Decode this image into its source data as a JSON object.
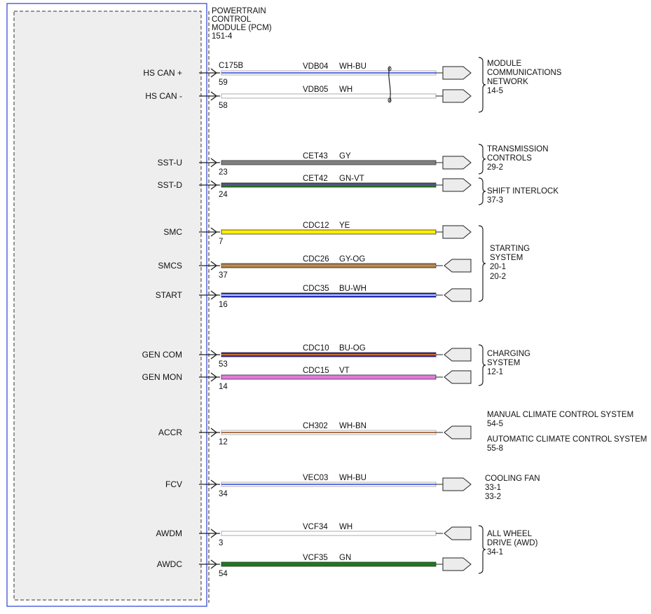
{
  "module": {
    "title_lines": [
      "POWERTRAIN",
      "CONTROL",
      "MODULE (PCM)",
      "151-4"
    ]
  },
  "connector": "C175B",
  "colors": {
    "module_border": "#2a3fd6",
    "module_fill": "#eeeeee",
    "connector_fill": "#ececec"
  },
  "wires": [
    {
      "pin_label": "HS CAN +",
      "pin": "59",
      "circuit": "VDB04",
      "color_code": "WH-BU",
      "fill": "#ffffff",
      "stripe": "#2a3fd6",
      "twisted": true,
      "direction": "out"
    },
    {
      "pin_label": "HS CAN -",
      "pin": "58",
      "circuit": "VDB05",
      "color_code": "WH",
      "fill": "#ffffff",
      "stripe": "",
      "twisted": true,
      "direction": "out"
    },
    {
      "pin_label": "SST-U",
      "pin": "23",
      "circuit": "CET43",
      "color_code": "GY",
      "fill": "#808080",
      "stripe": "",
      "direction": "out"
    },
    {
      "pin_label": "SST-D",
      "pin": "24",
      "circuit": "CET42",
      "color_code": "GN-VT",
      "fill": "#1e7a1e",
      "stripe": "#8a2be2",
      "direction": "out"
    },
    {
      "pin_label": "SMC",
      "pin": "7",
      "circuit": "CDC12",
      "color_code": "YE",
      "fill": "#ffee00",
      "stripe": "",
      "direction": "out"
    },
    {
      "pin_label": "SMCS",
      "pin": "37",
      "circuit": "CDC26",
      "color_code": "GY-OG",
      "fill": "#9a7a55",
      "stripe": "#ff8c00",
      "direction": "in"
    },
    {
      "pin_label": "START",
      "pin": "16",
      "circuit": "CDC35",
      "color_code": "BU-WH",
      "fill": "#1f2fd0",
      "stripe": "#ffffff",
      "direction": "in"
    },
    {
      "pin_label": "GEN COM",
      "pin": "53",
      "circuit": "CDC10",
      "color_code": "BU-OG",
      "fill": "#3a1fb0",
      "stripe": "#ff8c00",
      "direction": "in"
    },
    {
      "pin_label": "GEN MON",
      "pin": "14",
      "circuit": "CDC15",
      "color_code": "VT",
      "fill": "#e07ae0",
      "stripe": "",
      "direction": "in"
    },
    {
      "pin_label": "ACCR",
      "pin": "12",
      "circuit": "CH302",
      "color_code": "WH-BN",
      "fill": "#ffffff",
      "stripe": "#8b4513",
      "direction": "in"
    },
    {
      "pin_label": "FCV",
      "pin": "34",
      "circuit": "VEC03",
      "color_code": "WH-BU",
      "fill": "#ffffff",
      "stripe": "#2a3fd6",
      "direction": "out"
    },
    {
      "pin_label": "AWDM",
      "pin": "3",
      "circuit": "VCF34",
      "color_code": "WH",
      "fill": "#ffffff",
      "stripe": "",
      "direction": "in"
    },
    {
      "pin_label": "AWDC",
      "pin": "54",
      "circuit": "VCF35",
      "color_code": "GN",
      "fill": "#1e7a1e",
      "stripe": "",
      "direction": "out"
    }
  ],
  "destinations": [
    {
      "lines": [
        "MODULE",
        "COMMUNICATIONS",
        "NETWORK",
        "14-5"
      ],
      "bracket": true
    },
    {
      "lines": [
        "TRANSMISSION",
        "CONTROLS",
        "29-2"
      ],
      "bracket": true
    },
    {
      "lines": [
        "SHIFT INTERLOCK",
        "37-3"
      ],
      "bracket": true
    },
    {
      "lines": [
        "STARTING",
        "SYSTEM",
        "20-1",
        "20-2"
      ],
      "bracket": true
    },
    {
      "lines": [
        "CHARGING",
        "SYSTEM",
        "12-1"
      ],
      "bracket": true
    },
    {
      "lines": [
        "MANUAL CLIMATE CONTROL SYSTEM",
        "54-5",
        "AUTOMATIC CLIMATE CONTROL SYSTEM",
        "55-8"
      ],
      "bracket": false
    },
    {
      "lines": [
        "COOLING FAN",
        "33-1",
        "33-2"
      ],
      "bracket": false
    },
    {
      "lines": [
        "ALL WHEEL",
        "DRIVE (AWD)",
        "34-1"
      ],
      "bracket": true
    }
  ]
}
